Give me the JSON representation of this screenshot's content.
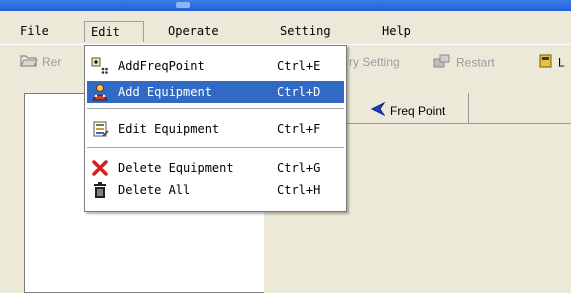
{
  "menubar": {
    "items": [
      {
        "label": "File"
      },
      {
        "label": "Edit"
      },
      {
        "label": "Operate"
      },
      {
        "label": "Setting"
      },
      {
        "label": "Help"
      }
    ]
  },
  "toolbar": {
    "buttons": [
      {
        "label": "Rer",
        "icon": "folder-open-icon"
      },
      {
        "label": "ry Setting",
        "icon": ""
      },
      {
        "label": "Restart",
        "icon": "restart-icon"
      },
      {
        "label": "L",
        "icon": "book-icon"
      }
    ]
  },
  "tabs": [
    {
      "label": "Freq Point",
      "icon": "arrow-left-icon"
    }
  ],
  "edit_menu": {
    "items": [
      {
        "label": "AddFreqPoint",
        "shortcut": "Ctrl+E",
        "icon": "add-freq-point-icon"
      },
      {
        "label": "Add Equipment",
        "shortcut": "Ctrl+D",
        "icon": "add-equipment-icon",
        "highlighted": true
      },
      {
        "label": "Edit Equipment",
        "shortcut": "Ctrl+F",
        "icon": "edit-equipment-icon"
      },
      {
        "label": "Delete Equipment",
        "shortcut": "Ctrl+G",
        "icon": "delete-x-icon"
      },
      {
        "label": "Delete All",
        "shortcut": "Ctrl+H",
        "icon": "trash-can-icon"
      }
    ]
  },
  "colors": {
    "highlight": "#316ac5",
    "menu_bg": "#ece9d8",
    "delete_red": "#d42020"
  }
}
